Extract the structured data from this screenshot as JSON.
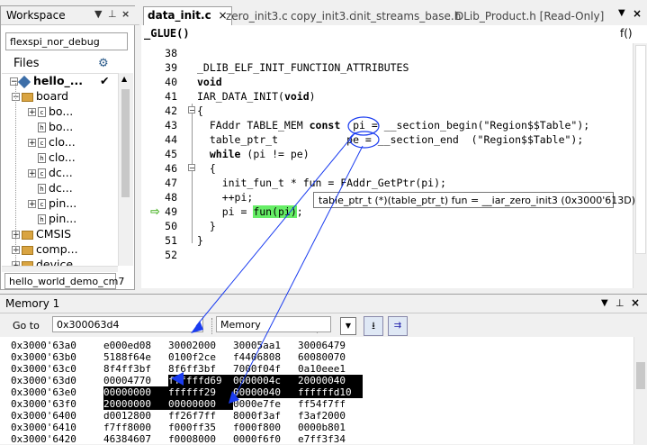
{
  "workspace": {
    "title": "Workspace",
    "config": "flexspi_nor_debug",
    "files_label": "Files",
    "project": "hello_...",
    "tree": [
      {
        "label": "board",
        "kind": "folder",
        "depth": 1,
        "exp": "minus"
      },
      {
        "label": "bo...",
        "kind": "file",
        "depth": 2,
        "exp": "plus",
        "glyph": "c"
      },
      {
        "label": "bo...",
        "kind": "file",
        "depth": 2,
        "exp": "",
        "glyph": "h"
      },
      {
        "label": "clo...",
        "kind": "file",
        "depth": 2,
        "exp": "plus",
        "glyph": "c"
      },
      {
        "label": "clo...",
        "kind": "file",
        "depth": 2,
        "exp": "",
        "glyph": "h"
      },
      {
        "label": "dc...",
        "kind": "file",
        "depth": 2,
        "exp": "plus",
        "glyph": "c"
      },
      {
        "label": "dc...",
        "kind": "file",
        "depth": 2,
        "exp": "",
        "glyph": "h"
      },
      {
        "label": "pin...",
        "kind": "file",
        "depth": 2,
        "exp": "plus",
        "glyph": "c"
      },
      {
        "label": "pin...",
        "kind": "file",
        "depth": 2,
        "exp": "",
        "glyph": "h"
      },
      {
        "label": "CMSIS",
        "kind": "folder",
        "depth": 1,
        "exp": "plus"
      },
      {
        "label": "comp...",
        "kind": "folder",
        "depth": 1,
        "exp": "plus"
      },
      {
        "label": "device",
        "kind": "folder",
        "depth": 1,
        "exp": "plus"
      }
    ],
    "bottom_tab": "hello_world_demo_cm7"
  },
  "editor": {
    "tabs": [
      {
        "label": "data_init.c",
        "active": true
      },
      {
        "label": "zero_init3.c",
        "active": false
      },
      {
        "label": "copy_init3.c",
        "active": false
      },
      {
        "label": "init_streams_base.h",
        "active": false
      },
      {
        "label": "DLib_Product.h [Read-Only]",
        "active": false
      }
    ],
    "function": "_GLUE()",
    "func_icon": "f()",
    "lines": [
      {
        "n": "38",
        "text": ""
      },
      {
        "n": "39",
        "text": "_DLIB_ELF_INIT_FUNCTION_ATTRIBUTES"
      },
      {
        "n": "40",
        "text": "void"
      },
      {
        "n": "41",
        "text": "IAR_DATA_INIT(void)"
      },
      {
        "n": "42",
        "text": "{"
      },
      {
        "n": "43",
        "text": "  FAddr TABLE_MEM const  pi = __section_begin(\"Region$$Table\");"
      },
      {
        "n": "44",
        "text": "  table_ptr_t           pe = __section_end  (\"Region$$Table\");"
      },
      {
        "n": "45",
        "text": "  while (pi != pe)"
      },
      {
        "n": "46",
        "text": "  {"
      },
      {
        "n": "47",
        "text": "    init_fun_t * fun = FAddr_GetPtr(pi);"
      },
      {
        "n": "48",
        "text": "    ++pi;"
      },
      {
        "n": "49",
        "text": "    pi = fun(pi);"
      },
      {
        "n": "50",
        "text": "  }"
      },
      {
        "n": "51",
        "text": "}"
      },
      {
        "n": "52",
        "text": ""
      }
    ],
    "tooltip": "table_ptr_t (*)(table_ptr_t) fun = __iar_zero_init3 (0x3000'613D)"
  },
  "memory": {
    "title": "Memory 1",
    "goto_label": "Go to",
    "goto_value": "0x300063d4",
    "zone": "Memory",
    "rows": [
      {
        "addr": "0x3000'63a0",
        "words": [
          "e000ed08",
          "30002000",
          "30005aa1",
          "30006479"
        ]
      },
      {
        "addr": "0x3000'63b0",
        "words": [
          "5188f64e",
          "0100f2ce",
          "f4406808",
          "60080070"
        ]
      },
      {
        "addr": "0x3000'63c0",
        "words": [
          "8f4ff3bf",
          "8f6ff3bf",
          "7000f04f",
          "0a10eee1"
        ]
      },
      {
        "addr": "0x3000'63d0",
        "words": [
          "00004770",
          "ffffffd69",
          "0000004c",
          "20000040"
        ]
      },
      {
        "addr": "0x3000'63e0",
        "words": [
          "00000000",
          "ffffff29",
          "00000040",
          "ffffffd10"
        ]
      },
      {
        "addr": "0x3000'63f0",
        "words": [
          "20000000",
          "00000000",
          "0000e7fe",
          "ff54f7ff"
        ]
      },
      {
        "addr": "0x3000'6400",
        "words": [
          "d0012800",
          "ff26f7ff",
          "8000f3af",
          "f3af2000"
        ]
      },
      {
        "addr": "0x3000'6410",
        "words": [
          "f7ff8000",
          "f000ff35",
          "f000f800",
          "0000b801"
        ]
      },
      {
        "addr": "0x3000'6420",
        "words": [
          "46384607",
          "f0008000",
          "0000f6f0",
          "e7ff3f34"
        ]
      }
    ]
  },
  "colors": {
    "highlight": "#000000",
    "annotation": "#1a3cf0",
    "exec_arrow": "#44b020",
    "current_call": "#66ee66"
  }
}
